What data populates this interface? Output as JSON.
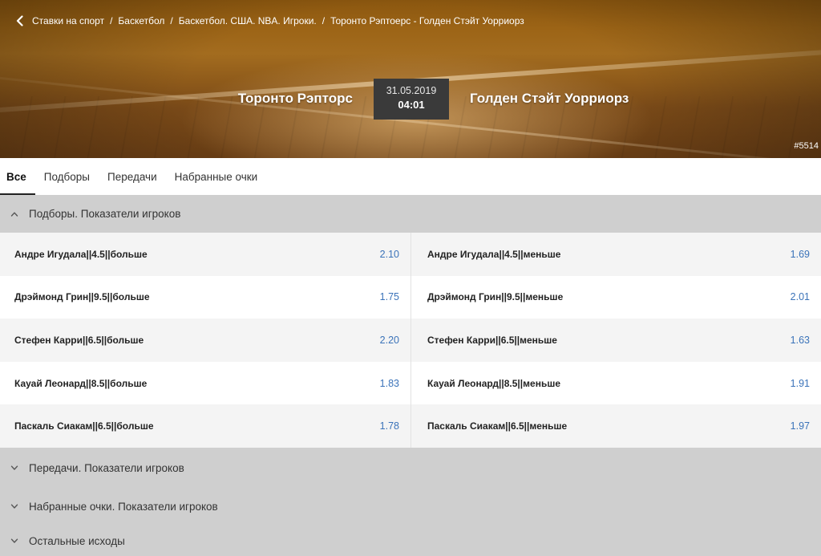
{
  "breadcrumbs": [
    "Ставки на спорт",
    "Баскетбол",
    "Баскетбол. США. NBA. Игроки.",
    "Торонто Рэптоерс - Голден Стэйт Уорриорз"
  ],
  "breadcrumb_separator": "/",
  "match": {
    "home": "Торонто Рэпторс",
    "away": "Голден Стэйт Уорриорз",
    "date": "31.05.2019",
    "time": "04:01",
    "event_id": "#5514"
  },
  "tabs": [
    {
      "label": "Все",
      "active": true
    },
    {
      "label": "Подборы",
      "active": false
    },
    {
      "label": "Передачи",
      "active": false
    },
    {
      "label": "Набранные очки",
      "active": false
    }
  ],
  "sections": [
    {
      "title": "Подборы. Показатели игроков",
      "expanded": true
    },
    {
      "title": "Передачи. Показатели игроков",
      "expanded": false
    },
    {
      "title": "Набранные очки. Показатели игроков",
      "expanded": false
    },
    {
      "title": "Остальные исходы",
      "expanded": false
    }
  ],
  "markets": [
    {
      "left": {
        "name": "Андре Игудала||4.5||больше",
        "odds": "2.10"
      },
      "right": {
        "name": "Андре Игудала||4.5||меньше",
        "odds": "1.69"
      }
    },
    {
      "left": {
        "name": "Дрэймонд Грин||9.5||больше",
        "odds": "1.75"
      },
      "right": {
        "name": "Дрэймонд Грин||9.5||меньше",
        "odds": "2.01"
      }
    },
    {
      "left": {
        "name": "Стефен Карри||6.5||больше",
        "odds": "2.20"
      },
      "right": {
        "name": "Стефен Карри||6.5||меньше",
        "odds": "1.63"
      }
    },
    {
      "left": {
        "name": "Кауай Леонард||8.5||больше",
        "odds": "1.83"
      },
      "right": {
        "name": "Кауай Леонард||8.5||меньше",
        "odds": "1.91"
      }
    },
    {
      "left": {
        "name": "Паскаль Сиакам||6.5||больше",
        "odds": "1.78"
      },
      "right": {
        "name": "Паскаль Сиакам||6.5||меньше",
        "odds": "1.97"
      }
    }
  ],
  "icons": {
    "back": "chevron-left-icon",
    "expanded": "chevron-up-icon",
    "collapsed": "chevron-down-icon"
  },
  "colors": {
    "odds": "#3b73b9",
    "section_bg": "#cfcfcf",
    "datebox_bg": "#3a3a3a"
  }
}
